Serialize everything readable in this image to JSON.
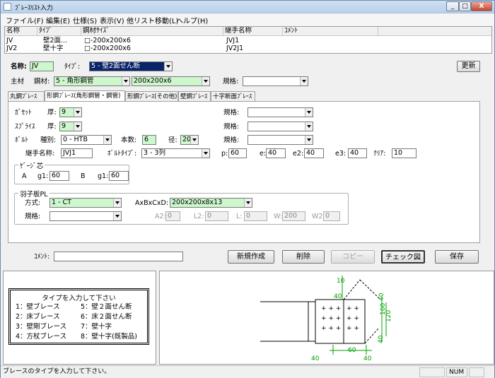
{
  "window": {
    "title": "ﾌﾞﾚｰｽﾘｽﾄ入力",
    "min": "_",
    "max": "□",
    "close": "X"
  },
  "menu": [
    "ファイル(F)",
    "編集(E)",
    "仕様(S)",
    "表示(V)",
    "他リスト移動(L)",
    "ヘルプ(H)"
  ],
  "list": {
    "headers": [
      "名称",
      "ﾀｲﾌﾟ",
      "鋼材ｻｲｽﾞ",
      "継手名称",
      "ｺﾒﾝﾄ"
    ],
    "rows": [
      [
        "JV",
        "壁2面...",
        "□-200x200x6",
        "JVJ1",
        ""
      ],
      [
        "JV2",
        "壁十字",
        "□-200x200x6",
        "JV2J1",
        ""
      ]
    ]
  },
  "form": {
    "name_label": "名称:",
    "name_value": "JV",
    "type_label": "ﾀｲﾌﾟ:",
    "type_value": "5 - 壁2面せん断",
    "update": "更新",
    "main_label": "主材",
    "steel_label": "鋼材:",
    "steel_value": "5 - 角形鋼管",
    "size_value": "200x200x6",
    "spec_label": "規格:",
    "spec_value": ""
  },
  "tabs": [
    "丸鋼ﾌﾞﾚｰｽ",
    "形鋼ﾌﾞﾚｰｽ(角形鋼管・鋼管)",
    "形鋼ﾌﾞﾚｰｽ(その他)",
    "壁鋼ﾌﾞﾚｰｽ",
    "十字断面ﾌﾞﾚｰｽ"
  ],
  "panel": {
    "gusset": "ｶﾞｾｯﾄ",
    "thick": "厚:",
    "gusset_t": "9",
    "splice": "ｽﾌﾟﾗｲｽ",
    "splice_t": "9",
    "spec": "規格:",
    "bolt": "ﾎﾞﾙﾄ",
    "kind": "種別:",
    "kind_value": "0 - HTB",
    "count": "本数:",
    "count_value": "6",
    "dia": "径:",
    "dia_value": "20",
    "joint": "継手名称:",
    "joint_value": "JVJ1",
    "bolt_type": "ﾎﾞﾙﾄﾀｲﾌﾟ:",
    "bolt_type_value": "3 - 3列",
    "p": "p:",
    "p_v": "60",
    "e": "e:",
    "e_v": "40",
    "e2": "e2:",
    "e2_v": "40",
    "e3": "e3:",
    "e3_v": "40",
    "clear": "ｸﾘｱ:",
    "clear_v": "10",
    "gauge": "ｹﾞｰｼﾞ芯",
    "a": "A",
    "g1a": "g1:",
    "g1a_v": "60",
    "bb": "B",
    "g1b": "g1:",
    "g1b_v": "60",
    "hane": "羽子板PL",
    "method": "方式:",
    "method_v": "1 - CT",
    "abcd": "AxBxCxD:",
    "abcd_v": "200x200x8x13",
    "spec2": "規格:",
    "a2": "A2:",
    "a2_v": "0",
    "l2": "L2:",
    "l2_v": "0",
    "l": "L:",
    "l_v": "0",
    "w": "W:",
    "w_v": "200",
    "w2": "W2:",
    "w2_v": "0"
  },
  "comment_label": "ｺﾒﾝﾄ:",
  "comment_value": "",
  "buttons": {
    "new": "新規作成",
    "delete": "削除",
    "copy": "コピー",
    "check": "チェック図",
    "save": "保存"
  },
  "help": {
    "title": "タイプを入力して下さい",
    "items": [
      "1：壁ブレース",
      "5：壁２面せん断",
      "2：床ブレース",
      "6：床２面せん断",
      "3：壁剛ブレース",
      "7：壁十字",
      "4：方杖ブレース",
      "8：壁十字(既製品)"
    ]
  },
  "drawing": {
    "labels": [
      "10",
      "40",
      "160",
      "120",
      "60",
      "40",
      "40",
      "40",
      "40"
    ]
  },
  "status": {
    "message": "ブレースのタイプを入力して下さい。",
    "num": "NUM"
  },
  "colors": {
    "input_green": "#cdf7cd",
    "selection": "#0a246a",
    "dim_green": "#00a000"
  }
}
